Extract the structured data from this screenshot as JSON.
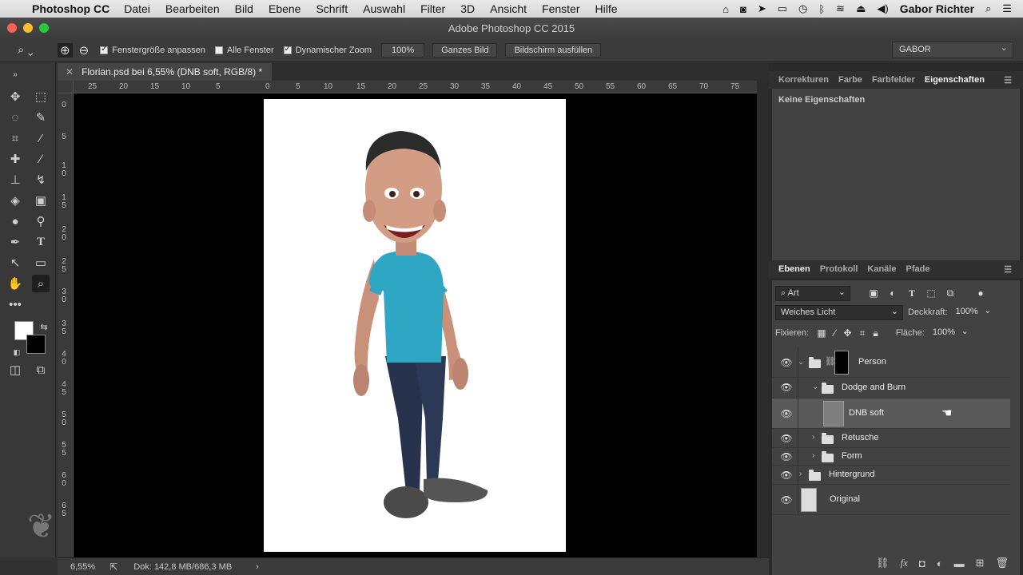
{
  "menubar": {
    "app": "Photoshop CC",
    "menus": [
      "Datei",
      "Bearbeiten",
      "Bild",
      "Ebene",
      "Schrift",
      "Auswahl",
      "Filter",
      "3D",
      "Ansicht",
      "Fenster",
      "Hilfe"
    ],
    "user": "Gabor Richter"
  },
  "window": {
    "title": "Adobe Photoshop CC 2015"
  },
  "options": {
    "fit_window": "Fenstergröße anpassen",
    "all_windows": "Alle Fenster",
    "dynamic_zoom": "Dynamischer Zoom",
    "zoom_value": "100%",
    "fit_screen": "Ganzes Bild",
    "fill_screen": "Bildschirm ausfüllen",
    "workspace": "GABOR"
  },
  "document": {
    "tab_title": "Florian.psd bei 6,55% (DNB soft, RGB/8) *",
    "h_ruler": [
      "25",
      "20",
      "15",
      "10",
      "5",
      "0",
      "5",
      "10",
      "15",
      "20",
      "25",
      "30",
      "35",
      "40",
      "45",
      "50",
      "55",
      "60",
      "65",
      "70",
      "75"
    ],
    "v_ruler": [
      "0",
      "5",
      "1\n0",
      "1\n5",
      "2\n0",
      "2\n5",
      "3\n0",
      "3\n5",
      "4\n0",
      "4\n5",
      "5\n0",
      "5\n5",
      "6\n0",
      "6\n5"
    ]
  },
  "status": {
    "zoom": "6,55%",
    "doc": "Dok: 142,8 MB/686,3 MB"
  },
  "properties_panel": {
    "tabs": [
      "Korrekturen",
      "Farbe",
      "Farbfelder",
      "Eigenschaften"
    ],
    "empty_text": "Keine Eigenschaften"
  },
  "layers_panel": {
    "tabs": [
      "Ebenen",
      "Protokoll",
      "Kanäle",
      "Pfade"
    ],
    "filter_kind": "Art",
    "blend_mode": "Weiches Licht",
    "opacity_label": "Deckkraft:",
    "opacity_value": "100%",
    "lock_label": "Fixieren:",
    "fill_label": "Fläche:",
    "fill_value": "100%",
    "layers": [
      {
        "name": "Person"
      },
      {
        "name": "Dodge and Burn"
      },
      {
        "name": "DNB soft"
      },
      {
        "name": "Retusche"
      },
      {
        "name": "Form"
      },
      {
        "name": "Hintergrund"
      },
      {
        "name": "Original"
      }
    ]
  }
}
